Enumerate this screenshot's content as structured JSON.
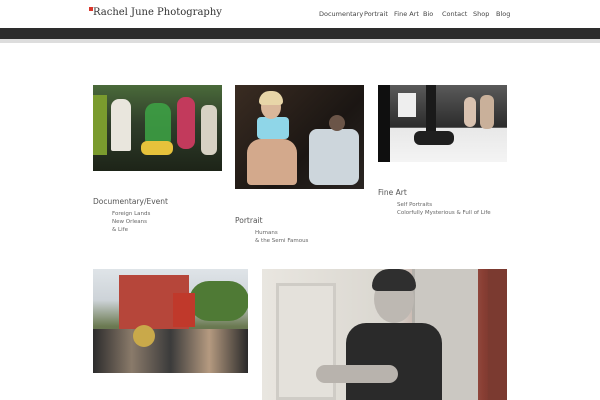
{
  "header": {
    "logo_text": "Rachel June Photography",
    "nav": [
      "Documentary",
      "Portrait",
      "Fine Art",
      "Bio",
      "Contact",
      "Shop",
      "Blog"
    ]
  },
  "sections": [
    {
      "title": "Documentary/Event",
      "links": [
        "Foreign Lands",
        "New Orleans",
        "& Life"
      ]
    },
    {
      "title": "Portrait",
      "links": [
        "Humans",
        "& the Semi Famous"
      ]
    },
    {
      "title": "Fine Art",
      "links": [
        "Self Portraits",
        "Colorfully Mysterious & Full of Life"
      ]
    }
  ],
  "colors": {
    "accent": "#d9362b",
    "band_dark": "#2d2d2d",
    "band_light": "#dddddd"
  }
}
